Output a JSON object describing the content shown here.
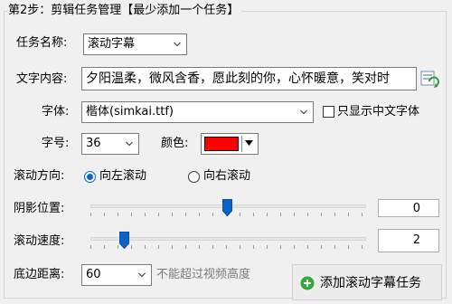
{
  "group": {
    "title": "第2步：剪辑任务管理【最少添加一个任务】"
  },
  "task_name": {
    "label": "任务名称:",
    "value": "滚动字幕"
  },
  "text_content": {
    "label": "文字内容:",
    "value": "夕阳温柔，微风含香，愿此刻的你，心怀暖意，笑对时"
  },
  "font": {
    "label": "字体:",
    "value": "楷体(simkai.ttf)",
    "only_chinese_label": "只显示中文字体",
    "only_chinese_checked": false
  },
  "font_size": {
    "label": "字号:",
    "value": "36"
  },
  "color": {
    "label": "颜色:",
    "value": "#ff0000"
  },
  "scroll_direction": {
    "label": "滚动方向:",
    "options": [
      {
        "label": "向左滚动",
        "selected": true
      },
      {
        "label": "向右滚动",
        "selected": false
      }
    ]
  },
  "shadow_position": {
    "label": "阴影位置:",
    "value": "0"
  },
  "scroll_speed": {
    "label": "滚动速度:",
    "value": "2"
  },
  "bottom_margin": {
    "label": "底边距离:",
    "value": "60",
    "hint": "不能超过视频高度"
  },
  "add_button": {
    "label": "添加滚动字幕任务"
  },
  "colors": {
    "accent": "#0a64c8",
    "add_icon_green": "#35a83a"
  }
}
